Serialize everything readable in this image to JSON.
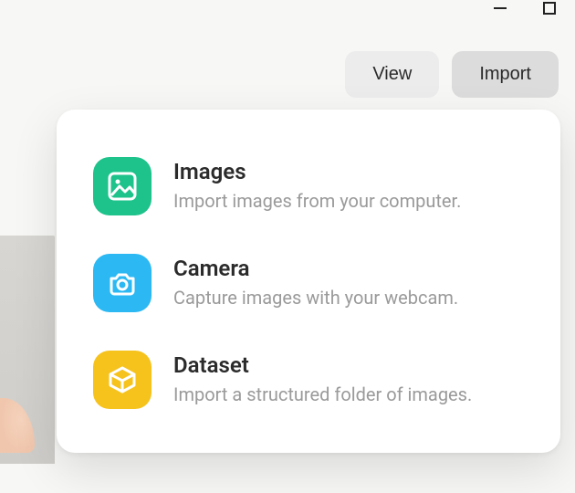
{
  "toolbar": {
    "view_label": "View",
    "import_label": "Import"
  },
  "popover": {
    "options": [
      {
        "title": "Images",
        "desc": "Import images from your computer.",
        "icon_name": "image-icon",
        "tile_color": "#1ec28b"
      },
      {
        "title": "Camera",
        "desc": "Capture images with your webcam.",
        "icon_name": "camera-icon",
        "tile_color": "#2bb8f3"
      },
      {
        "title": "Dataset",
        "desc": "Import a structured folder of images.",
        "icon_name": "cube-icon",
        "tile_color": "#f6c21c"
      }
    ]
  }
}
